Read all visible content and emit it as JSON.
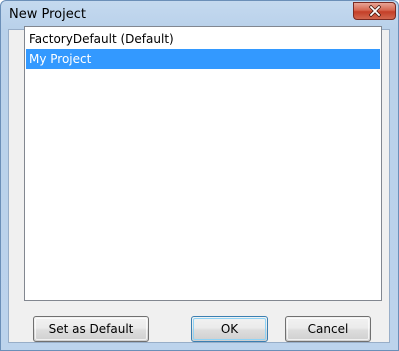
{
  "window": {
    "title": "New Project"
  },
  "projects": {
    "items": [
      {
        "label": "FactoryDefault (Default)",
        "selected": false
      },
      {
        "label": "My Project",
        "selected": true
      }
    ]
  },
  "buttons": {
    "set_default_label": "Set as Default",
    "ok_label": "OK",
    "cancel_label": "Cancel"
  },
  "icons": {
    "close": "close-icon"
  },
  "colors": {
    "selection": "#3399ff",
    "close_button": "#c43f28",
    "title_bar": "#b9d1ea"
  }
}
